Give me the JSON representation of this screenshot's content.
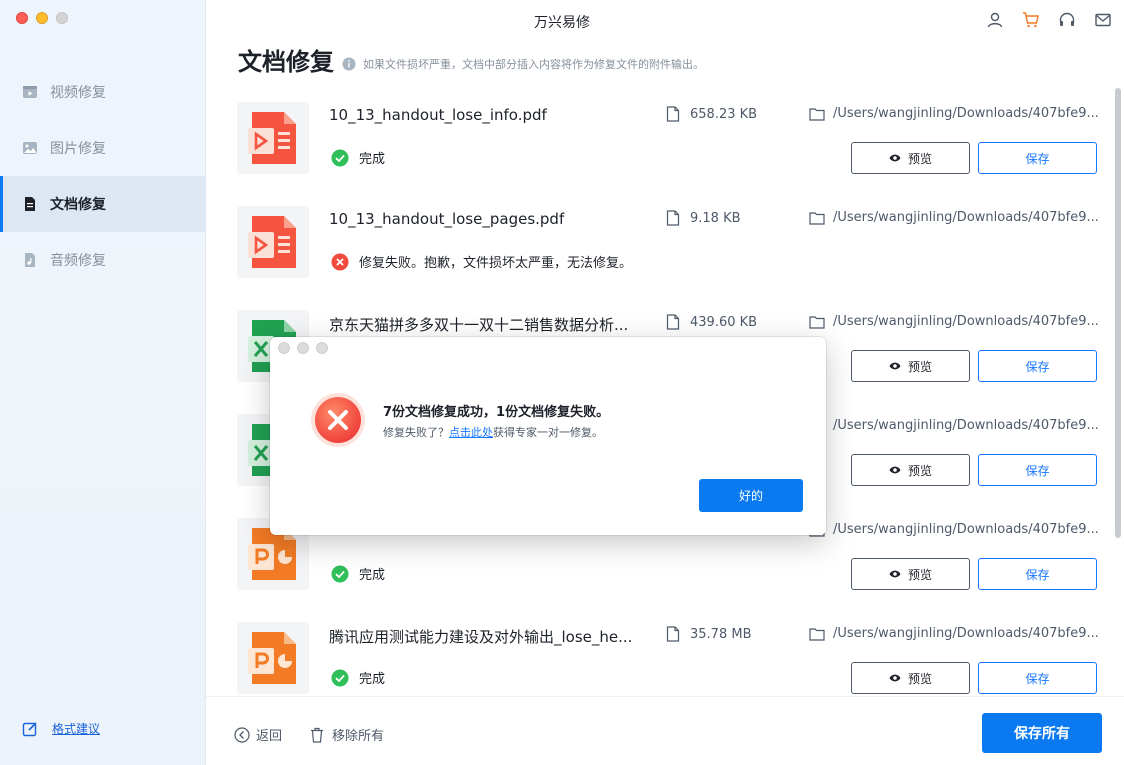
{
  "window": {
    "title": "万兴易修"
  },
  "sidebar": {
    "items": [
      {
        "label": "视频修复",
        "icon": "video-icon"
      },
      {
        "label": "图片修复",
        "icon": "image-icon"
      },
      {
        "label": "文档修复",
        "icon": "document-icon",
        "active": true
      },
      {
        "label": "音频修复",
        "icon": "audio-icon"
      }
    ],
    "feedback_label": "格式建议"
  },
  "header": {
    "title": "文档修复",
    "hint": "如果文件损坏严重，文档中部分插入内容将作为修复文件的附件输出。"
  },
  "files": [
    {
      "name": "10_13_handout_lose_info.pdf",
      "size": "658.23 KB",
      "path": "/Users/wangjinling/Downloads/407bfe9...",
      "status": "完成",
      "status_type": "success",
      "type": "pdf"
    },
    {
      "name": "10_13_handout_lose_pages.pdf",
      "size": "9.18 KB",
      "path": "/Users/wangjinling/Downloads/407bfe9...",
      "status": "修复失败。抱歉，文件损坏太严重，无法修复。",
      "status_type": "error",
      "type": "pdf"
    },
    {
      "name": "京东天猫拼多多双十一双十二销售数据分析...",
      "size": "439.60 KB",
      "path": "/Users/wangjinling/Downloads/407bfe9...",
      "status": "",
      "status_type": "hidden",
      "type": "excel"
    },
    {
      "name": "",
      "size": "",
      "path": "/Users/wangjinling/Downloads/407bfe9...",
      "status": "",
      "status_type": "hidden",
      "type": "excel"
    },
    {
      "name": "",
      "size": "",
      "path": "/Users/wangjinling/Downloads/407bfe9...",
      "status": "完成",
      "status_type": "success",
      "type": "ppt"
    },
    {
      "name": "腾讯应用测试能力建设及对外输出_lose_he...",
      "size": "35.78 MB",
      "path": "/Users/wangjinling/Downloads/407bfe9...",
      "status": "完成",
      "status_type": "success",
      "type": "ppt"
    }
  ],
  "buttons": {
    "preview": "预览",
    "save": "保存",
    "back": "返回",
    "remove_all": "移除所有",
    "save_all": "保存所有"
  },
  "dialog": {
    "title": "7份文档修复成功，1份文档修复失败。",
    "sub_prefix": "修复失败了？",
    "sub_link": "点击此处",
    "sub_suffix": "获得专家一对一修复。",
    "ok": "好的"
  },
  "colors": {
    "accent": "#0b7af0",
    "success": "#2fbf5b",
    "error": "#f04b3c",
    "pdf": "#f5553e",
    "excel": "#21a152",
    "ppt": "#f37b25"
  }
}
